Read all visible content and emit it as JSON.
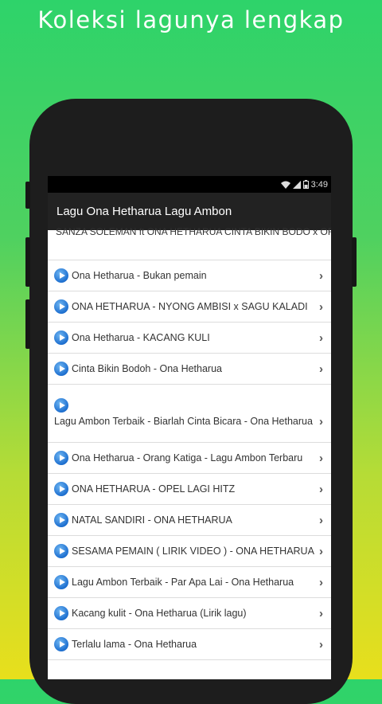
{
  "promo": {
    "title": "Koleksi lagunya lengkap"
  },
  "status_bar": {
    "time": "3:49"
  },
  "app_bar": {
    "title": "Lagu Ona Hetharua Lagu Ambon"
  },
  "items": [
    {
      "label": "SANZA SOLEMAN ft ONA HETHARUA CINTA BIKIN BODO x ORANG LAIN PU JODOH"
    },
    {
      "label": "Ona Hetharua - Bukan pemain"
    },
    {
      "label": "ONA HETHARUA - NYONG AMBISI x SAGU KALADI"
    },
    {
      "label": "Ona Hetharua - KACANG KULI"
    },
    {
      "label": "Cinta Bikin Bodoh - Ona Hetharua"
    },
    {
      "label": "Lagu Ambon Terbaik - Biarlah Cinta Bicara - Ona Hetharua Feat Evert Titahena"
    },
    {
      "label": "Ona Hetharua - Orang Katiga - Lagu Ambon Terbaru"
    },
    {
      "label": "ONA HETHARUA - OPEL LAGI HITZ"
    },
    {
      "label": "NATAL SANDIRI - ONA HETHARUA"
    },
    {
      "label": "SESAMA PEMAIN ( LIRIK VIDEO ) - ONA HETHARUA"
    },
    {
      "label": "Lagu Ambon Terbaik - Par Apa Lai - Ona Hetharua"
    },
    {
      "label": "Kacang kulit - Ona Hetharua (Lirik lagu)"
    },
    {
      "label": "Terlalu lama - Ona Hetharua"
    }
  ]
}
